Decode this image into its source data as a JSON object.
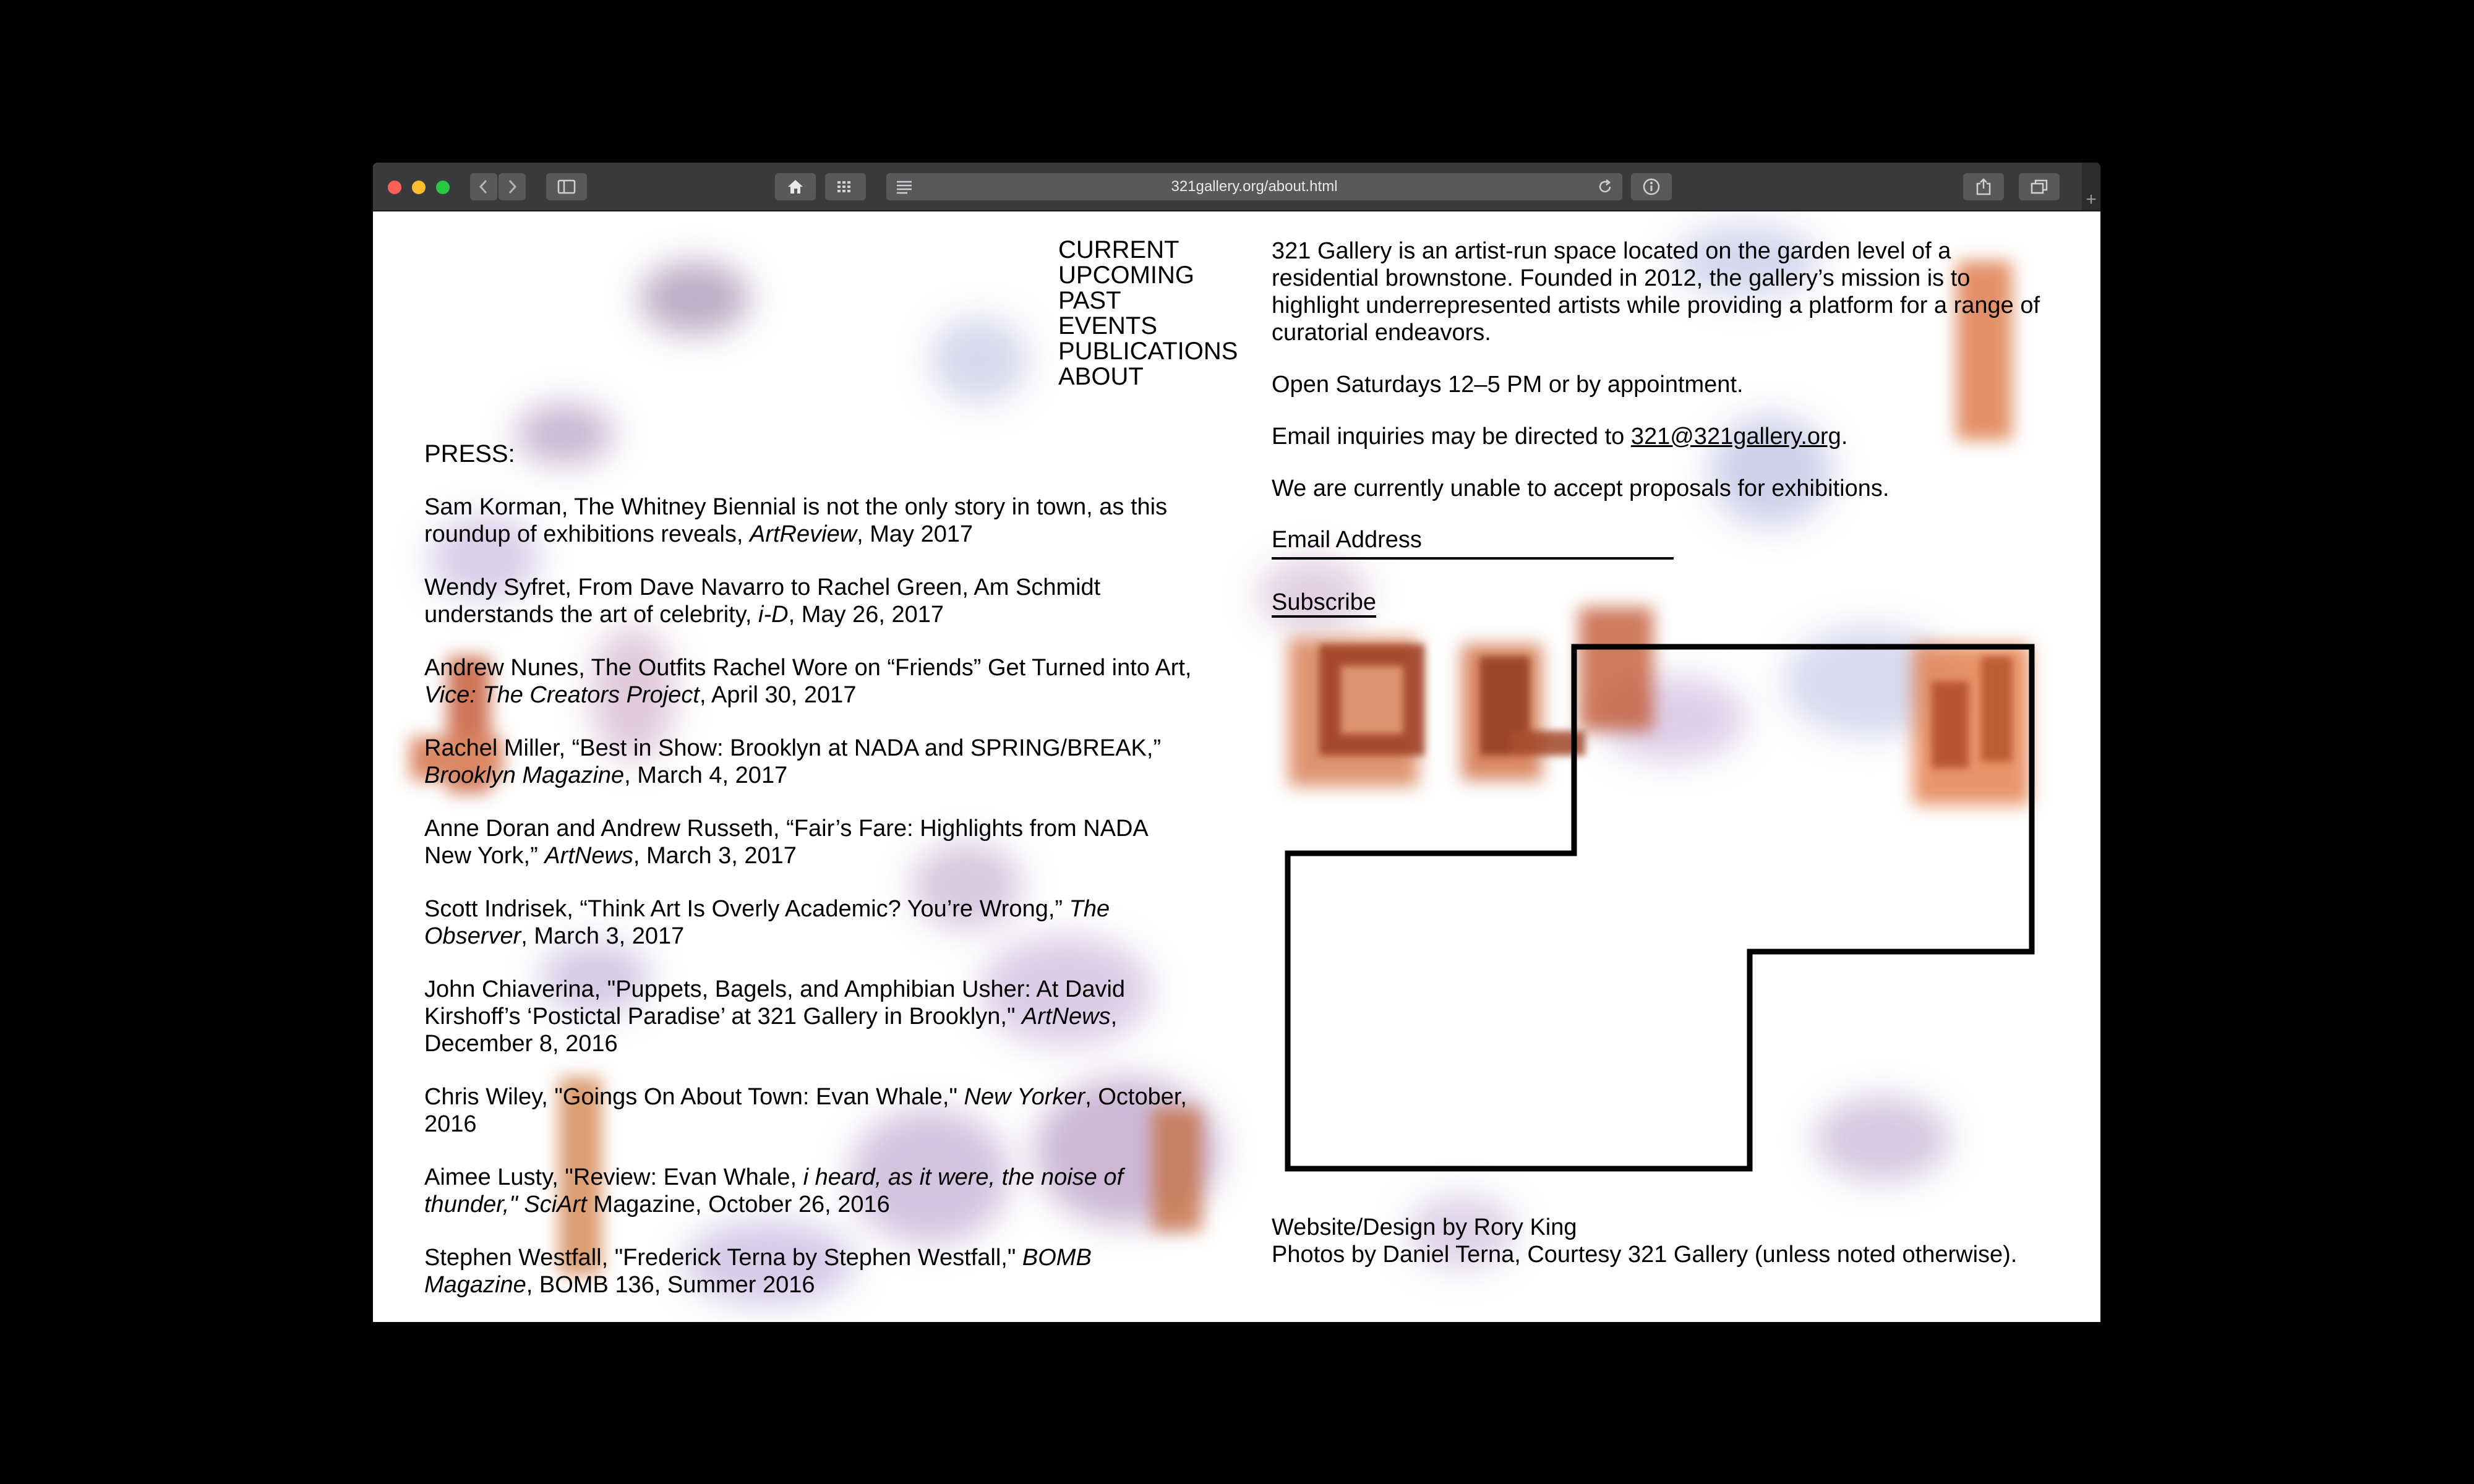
{
  "browser": {
    "url": "321gallery.org/about.html",
    "icons": [
      "back-icon",
      "forward-icon",
      "sidebar-icon",
      "home-icon",
      "grid-icon",
      "reader-icon",
      "reload-icon",
      "info-icon",
      "share-icon",
      "tabs-icon",
      "plus-icon"
    ]
  },
  "nav": {
    "items": [
      "CURRENT",
      "UPCOMING",
      "PAST",
      "EVENTS",
      "PUBLICATIONS",
      "ABOUT"
    ]
  },
  "press": {
    "heading": "PRESS:",
    "entries": [
      {
        "a": "Sam Korman, The Whitney Biennial is not the only story in town, as this roundup of exhibitions reveals, ",
        "i": "ArtReview",
        "b": ", May 2017"
      },
      {
        "a": "Wendy Syfret, From Dave Navarro to Rachel Green, Am Schmidt understands the art of celebrity, ",
        "i": "i-D",
        "b": ", May 26, 2017"
      },
      {
        "a": "Andrew Nunes, The Outfits Rachel Wore on “Friends” Get Turned into Art, ",
        "i": "Vice: The Creators Project",
        "b": ", April 30, 2017"
      },
      {
        "a": "Rachel Miller, “Best in Show: Brooklyn at NADA and SPRING/BREAK,” ",
        "i": "Brooklyn Magazine",
        "b": ", March 4, 2017"
      },
      {
        "a": "Anne Doran and Andrew Russeth, “Fair’s Fare: Highlights from NADA New York,” ",
        "i": "ArtNews",
        "b": ", March 3, 2017"
      },
      {
        "a": "Scott Indrisek, “Think Art Is Overly Academic? You’re Wrong,” ",
        "i": "The Observer",
        "b": ", March 3, 2017"
      },
      {
        "a": "John Chiaverina, \"Puppets, Bagels, and Amphibian Usher: At David Kirshoff’s ‘Postictal Paradise’ at 321 Gallery in Brooklyn,\" ",
        "i": "ArtNews",
        "b": ", December 8, 2016"
      },
      {
        "a": "Chris Wiley, \"Goings On About Town: Evan Whale,\" ",
        "i": "New Yorker",
        "b": ", October, 2016"
      },
      {
        "a": "Aimee Lusty, \"Review: Evan Whale, ",
        "i": "i heard, as it were, the noise of thunder,\" SciArt",
        "b": " Magazine, October 26, 2016"
      },
      {
        "a": "Stephen Westfall, \"Frederick Terna by Stephen Westfall,\" ",
        "i": "BOMB Magazine",
        "b": ", BOMB 136, Summer 2016"
      }
    ]
  },
  "about": {
    "intro": "321 Gallery is an artist-run space located on the garden level of a residential brownstone. Founded in 2012, the gallery’s mission is to highlight underrepresented artists while providing a platform for a range of curatorial endeavors.",
    "hours": "Open Saturdays 12–5 PM or by appointment.",
    "email_prefix": "Email inquiries may be directed to ",
    "email": "321@321gallery.org",
    "email_suffix": ".",
    "proposals": "We are currently unable to accept proposals for exhibitions.",
    "email_placeholder": "Email Address",
    "subscribe": "Subscribe"
  },
  "credits": {
    "line1": "Website/Design by Rory King",
    "line2": "Photos by Daniel Terna, Courtesy 321 Gallery (unless noted otherwise)."
  }
}
